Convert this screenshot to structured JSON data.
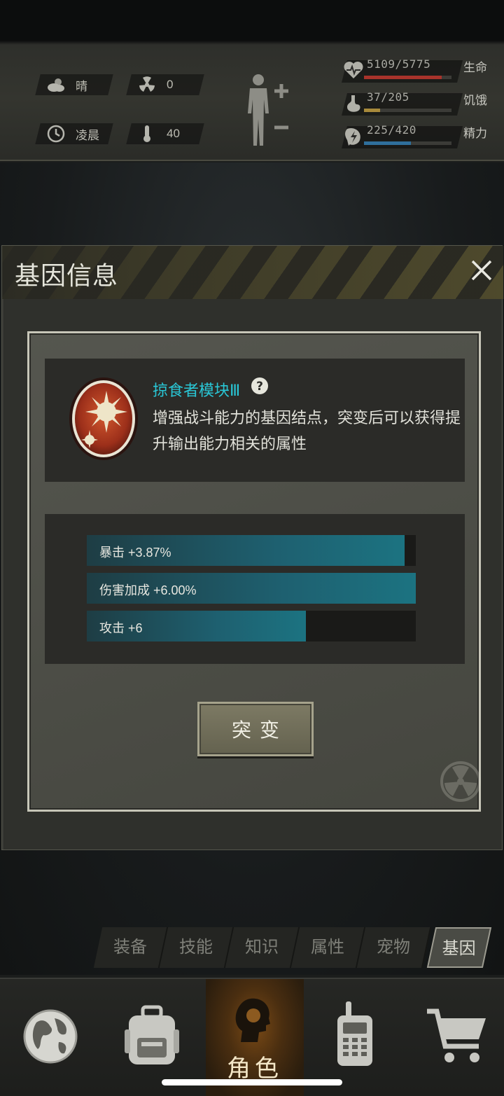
{
  "status": {
    "weather": {
      "icon": "cloud-sun-icon",
      "label": "晴"
    },
    "radiation": {
      "icon": "radiation-icon",
      "value": "0"
    },
    "time": {
      "icon": "clock-icon",
      "label": "凌晨"
    },
    "temperature": {
      "icon": "thermometer-icon",
      "value": "40"
    },
    "stats": [
      {
        "icon": "heart-icon",
        "value": "5109/5775",
        "label": "生命",
        "fraction": 0.885,
        "color": "#a8332b"
      },
      {
        "icon": "stomach-icon",
        "value": "37/205",
        "label": "饥饿",
        "fraction": 0.18,
        "color": "#a88a3b"
      },
      {
        "icon": "energy-icon",
        "value": "225/420",
        "label": "精力",
        "fraction": 0.536,
        "color": "#2f6f9c"
      }
    ]
  },
  "modal": {
    "title": "基因信息",
    "gene": {
      "name": "掠食者模块Ⅲ",
      "description": "增强战斗能力的基因结点，突变后可以获得提升输出能力相关的属性"
    },
    "attributes": [
      {
        "label": "暴击 +3.87%",
        "fraction": 0.967
      },
      {
        "label": "伤害加成 +6.00%",
        "fraction": 1.0
      },
      {
        "label": "攻击 +6",
        "fraction": 0.666
      }
    ],
    "mutate_label": "突变"
  },
  "tabs": [
    {
      "label": "装备",
      "active": false
    },
    {
      "label": "技能",
      "active": false
    },
    {
      "label": "知识",
      "active": false
    },
    {
      "label": "属性",
      "active": false
    },
    {
      "label": "宠物",
      "active": false
    },
    {
      "label": "基因",
      "active": true
    }
  ],
  "nav": [
    {
      "icon": "globe-icon",
      "label": ""
    },
    {
      "icon": "backpack-icon",
      "label": ""
    },
    {
      "icon": "character-icon",
      "label": "角色",
      "active": true
    },
    {
      "icon": "radio-icon",
      "label": ""
    },
    {
      "icon": "cart-icon",
      "label": ""
    }
  ]
}
